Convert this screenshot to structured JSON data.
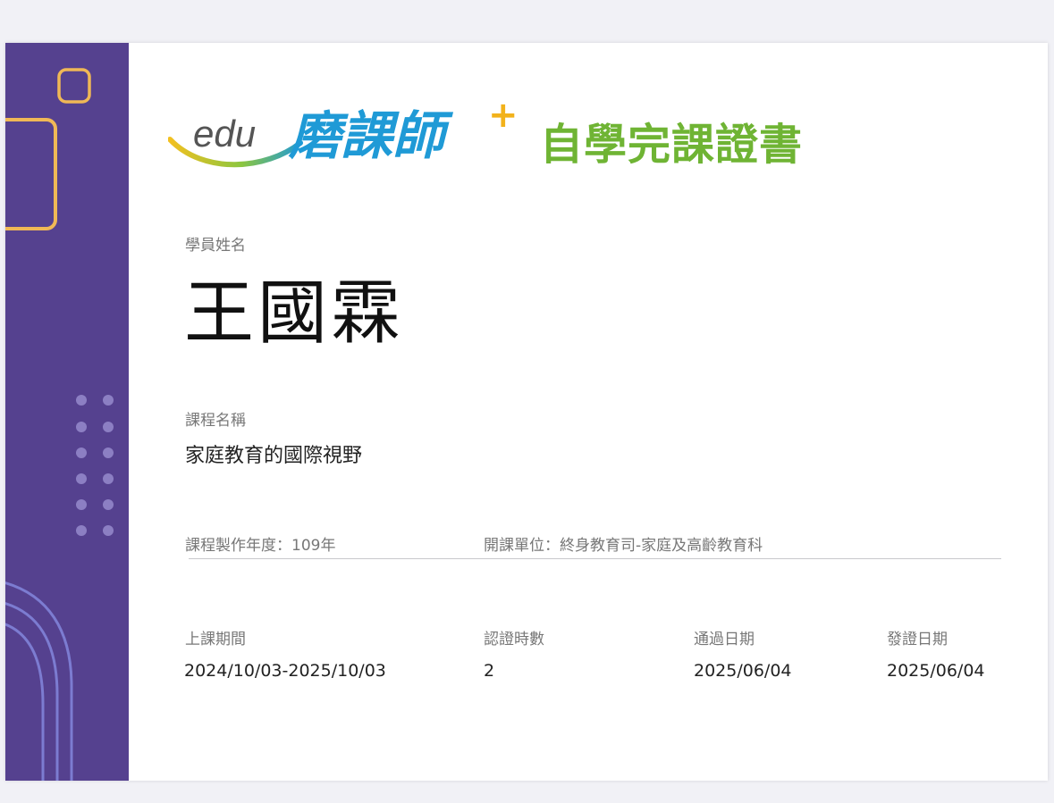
{
  "logo": {
    "edu_text": "edu",
    "brand_text": "磨課師",
    "plus_text": "+"
  },
  "certificate_title": "自學完課證書",
  "student": {
    "label": "學員姓名",
    "name": "王國霖"
  },
  "course": {
    "label": "課程名稱",
    "name": "家庭教育的國際視野"
  },
  "production_year": "課程製作年度：109年",
  "organizer": "開課單位：終身教育司-家庭及高齡教育科",
  "details": {
    "period_label": "上課期間",
    "period_value": "2024/10/03-2025/10/03",
    "hours_label": "認證時數",
    "hours_value": "2",
    "pass_date_label": "通過日期",
    "pass_date_value": "2025/06/04",
    "issue_date_label": "發證日期",
    "issue_date_value": "2025/06/04"
  },
  "colors": {
    "sidebar": "#55418f",
    "accent_orange": "#f0b856",
    "title_green": "#6fb434",
    "logo_blue": "#1f9ad6"
  }
}
